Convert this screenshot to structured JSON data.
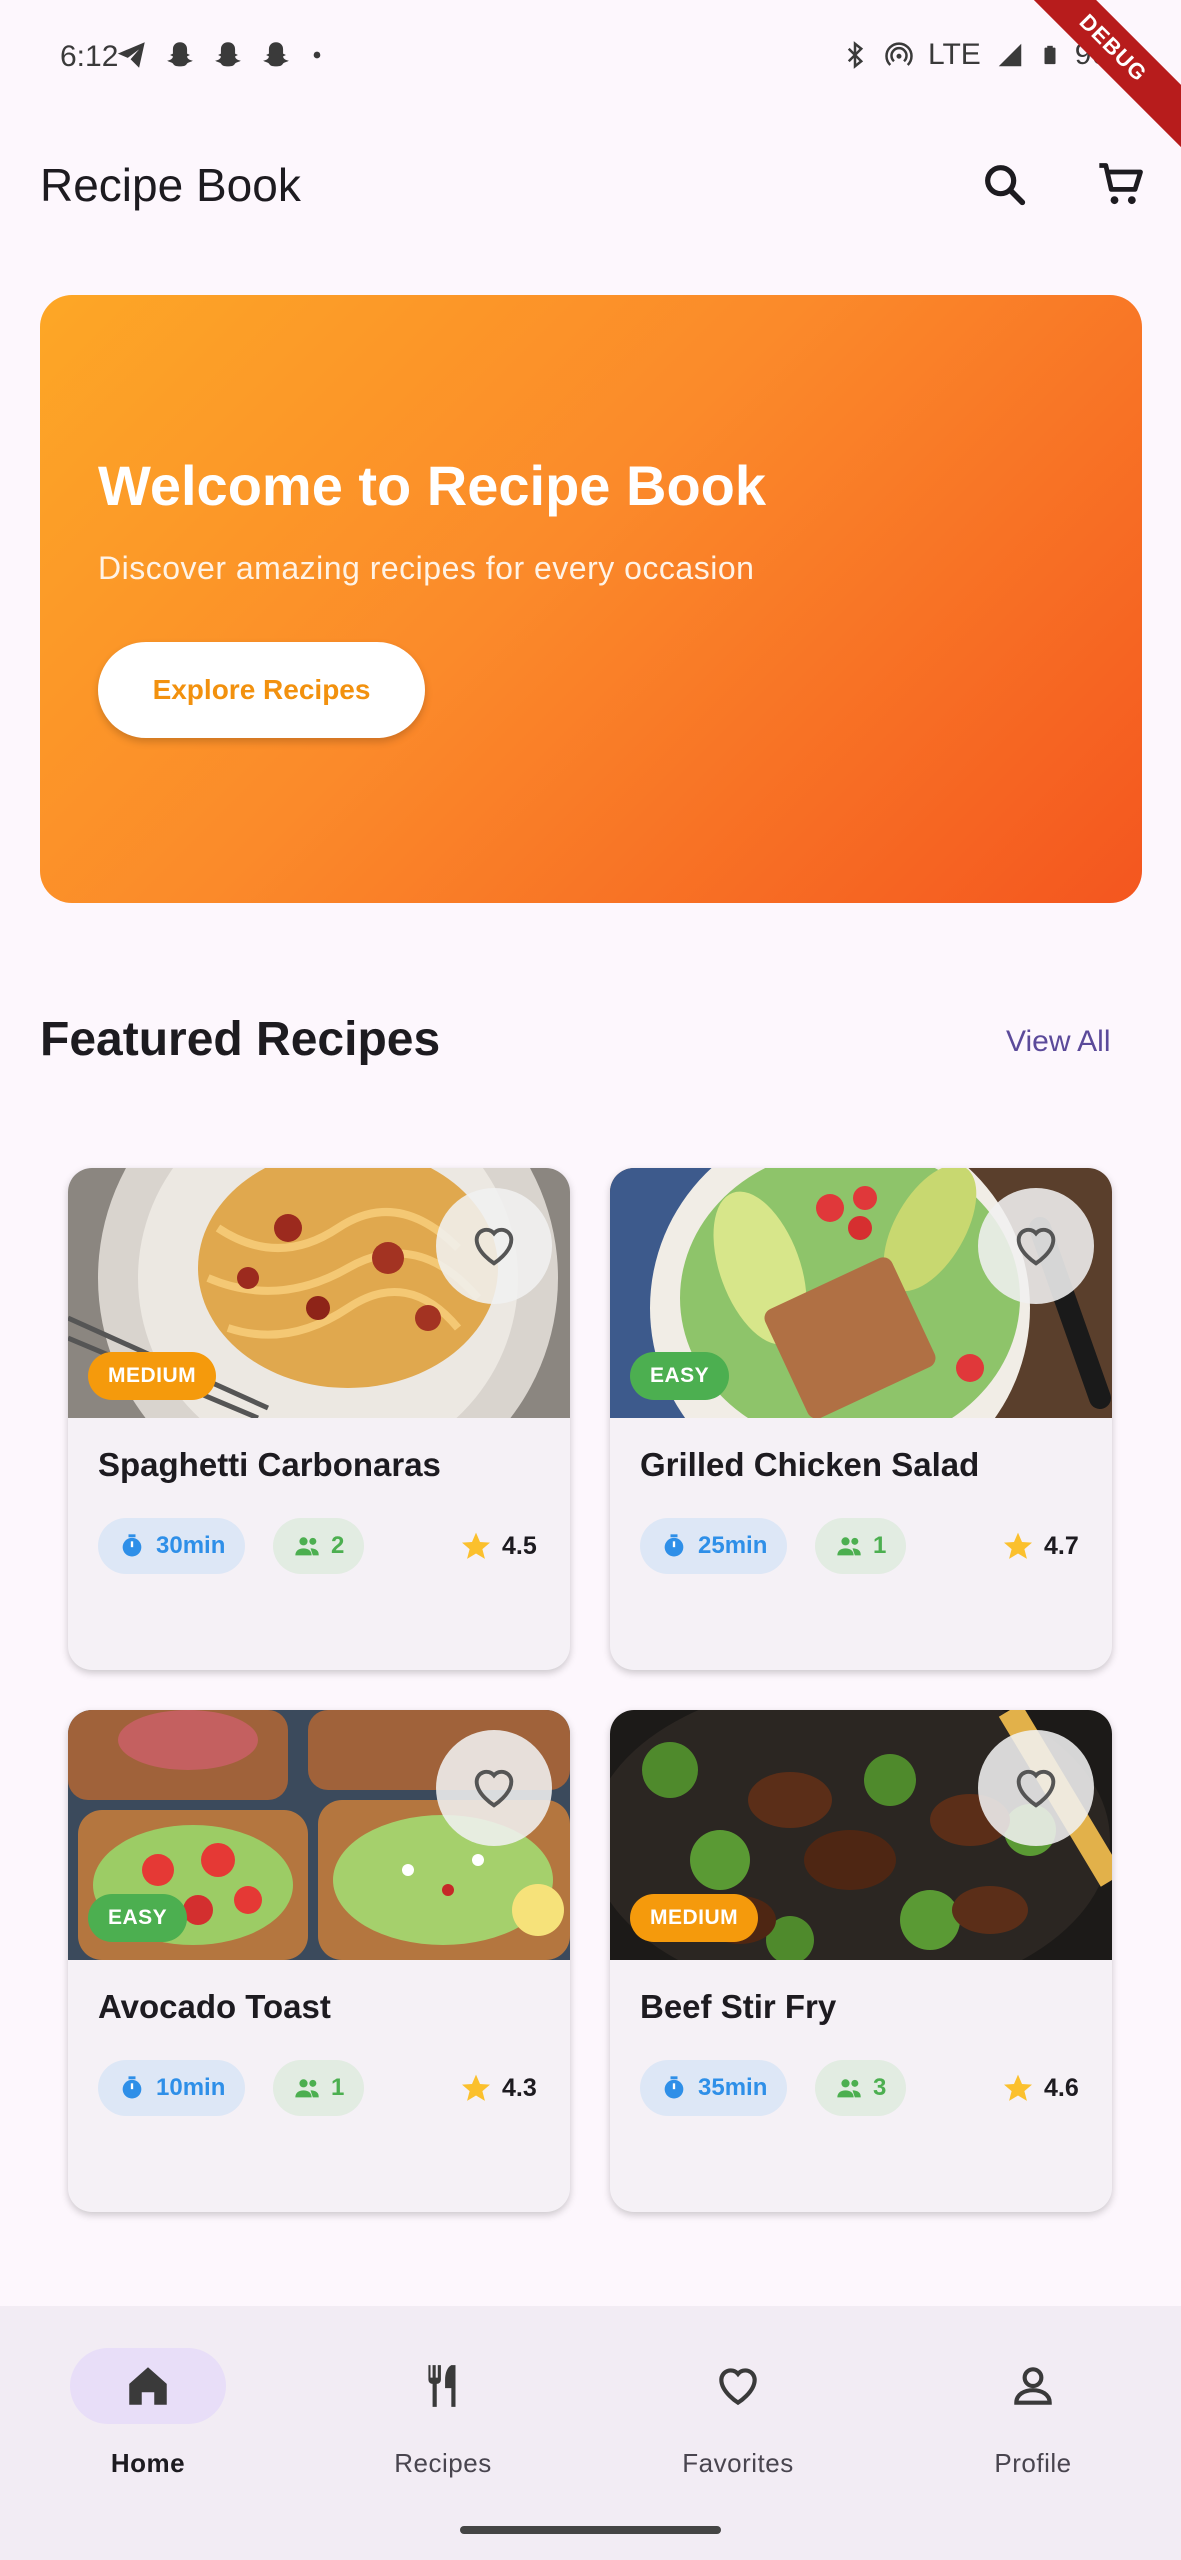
{
  "status_bar": {
    "time": "6:12",
    "network": "LTE",
    "battery": "96%",
    "debug_label": "DEBUG",
    "left_icons": [
      "telegram-icon",
      "snapchat-icon",
      "snapchat-icon",
      "snapchat-icon",
      "dot-icon"
    ],
    "right_icons": [
      "bluetooth-icon",
      "hotspot-icon",
      "signal-icon",
      "battery-icon"
    ]
  },
  "app_bar": {
    "title": "Recipe Book",
    "actions": [
      "search-icon",
      "cart-icon"
    ]
  },
  "hero": {
    "title": "Welcome to Recipe Book",
    "subtitle": "Discover amazing recipes for every occasion",
    "button_label": "Explore Recipes",
    "gradient_start": "#fda726",
    "gradient_end": "#f4561f"
  },
  "featured": {
    "title": "Featured Recipes",
    "view_all": "View All",
    "recipes": [
      {
        "name": "Spaghetti Carbonaras",
        "difficulty": "MEDIUM",
        "time": "30min",
        "servings": "2",
        "rating": "4.5",
        "favorite": false
      },
      {
        "name": "Grilled Chicken Salad",
        "difficulty": "EASY",
        "time": "25min",
        "servings": "1",
        "rating": "4.7",
        "favorite": false
      },
      {
        "name": "Avocado Toast",
        "difficulty": "EASY",
        "time": "10min",
        "servings": "1",
        "rating": "4.3",
        "favorite": false
      },
      {
        "name": "Beef Stir Fry",
        "difficulty": "MEDIUM",
        "time": "35min",
        "servings": "3",
        "rating": "4.6",
        "favorite": false
      }
    ]
  },
  "colors": {
    "accent": "#5b4a9a",
    "medium_badge": "#f59a0c",
    "easy_badge": "#4caf50",
    "time_chip": "#2e8fe8",
    "servings_chip": "#4caf50",
    "star": "#fbc02d"
  },
  "bottom_nav": {
    "items": [
      {
        "label": "Home",
        "icon": "home-icon",
        "active": true
      },
      {
        "label": "Recipes",
        "icon": "restaurant-icon",
        "active": false
      },
      {
        "label": "Favorites",
        "icon": "heart-icon",
        "active": false
      },
      {
        "label": "Profile",
        "icon": "person-icon",
        "active": false
      }
    ]
  }
}
